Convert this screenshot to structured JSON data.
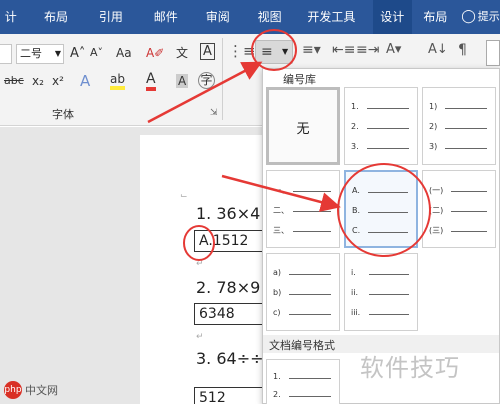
{
  "tabs": [
    "计",
    "布局",
    "引用",
    "邮件",
    "审阅",
    "视图",
    "开发工具",
    "设计",
    "布局",
    "提示"
  ],
  "ribbon": {
    "font_size": "二号",
    "grow": "A˄",
    "shrink": "A˅",
    "change_case": "Aa",
    "clear": "A✐",
    "phonetic": "文",
    "border_char": "A",
    "strike": "abc",
    "sub": "x₂",
    "sup": "x²",
    "effects": "A",
    "highlight": "ab",
    "font_color": "A",
    "shade": "A",
    "enclose": "字",
    "group_label": "字体",
    "dialog_launcher": "⇲"
  },
  "menu": {
    "library_title": "编号库",
    "none_label": "无",
    "cells": [
      {
        "labels": [
          "1.",
          "2.",
          "3."
        ]
      },
      {
        "labels": [
          "1)",
          "2)",
          "3)"
        ]
      },
      {
        "labels": [
          "一、",
          "二、",
          "三、"
        ]
      },
      {
        "labels": [
          "A.",
          "B.",
          "C."
        ]
      },
      {
        "labels": [
          "(一)",
          "(二)",
          "(三)"
        ]
      },
      {
        "labels": [
          "a)",
          "b)",
          "c)"
        ]
      },
      {
        "labels": [
          "i.",
          "ii.",
          "iii."
        ]
      }
    ],
    "doc_title": "文档编号格式",
    "doc_cell": {
      "labels": [
        "1.",
        "2."
      ]
    }
  },
  "document": {
    "questions": [
      {
        "text": "1.  36×4",
        "answer": "A.1512"
      },
      {
        "text": "2.  78×9",
        "answer": "6348"
      },
      {
        "text": "3.  64÷÷",
        "answer": "512"
      }
    ]
  },
  "watermark": "软件技巧",
  "logo": {
    "badge": "php",
    "text": "中文网"
  }
}
